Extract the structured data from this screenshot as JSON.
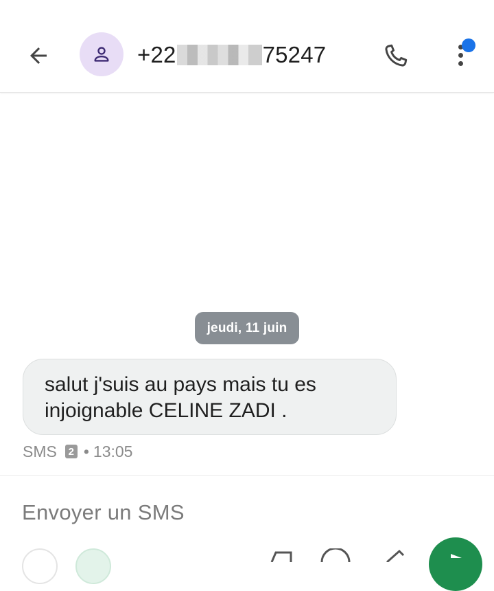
{
  "header": {
    "contact_number_prefix": "+22",
    "contact_number_suffix": "75247",
    "back_icon": "arrow-left-icon",
    "avatar_icon": "person-icon",
    "call_icon": "phone-icon",
    "more_icon": "more-vertical-icon",
    "notification_color": "#1a73e8"
  },
  "conversation": {
    "date_chip": "jeudi, 11 juin",
    "messages": [
      {
        "line1": "salut j'suis au pays mais tu es",
        "line2": "injoignable CELINE ZADI .",
        "type": "SMS",
        "sim": "2",
        "time": "13:05"
      }
    ]
  },
  "compose": {
    "placeholder": "Envoyer un SMS",
    "send_color": "#1e8e4e"
  }
}
